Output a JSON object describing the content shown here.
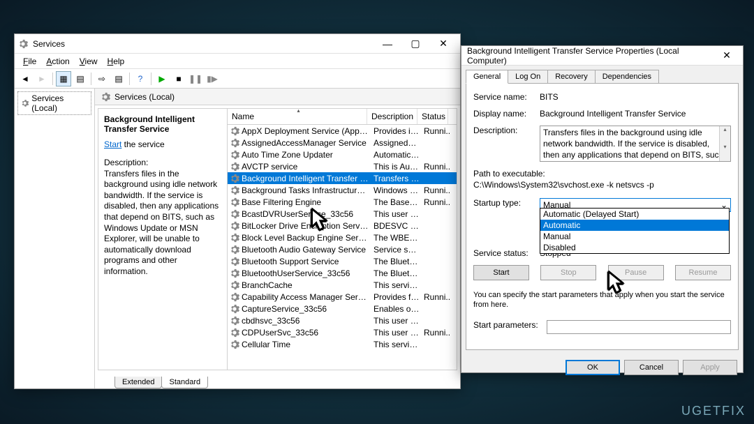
{
  "services_window": {
    "title": "Services",
    "menu": {
      "file": "File",
      "action": "Action",
      "view": "View",
      "help": "Help"
    },
    "tree_item": "Services (Local)",
    "panel_header": "Services (Local)",
    "selected_service": {
      "title": "Background Intelligent Transfer Service",
      "action_prefix": "Start",
      "action_suffix": " the service",
      "desc_label": "Description:",
      "description": "Transfers files in the background using idle network bandwidth. If the service is disabled, then any applications that depend on BITS, such as Windows Update or MSN Explorer, will be unable to automatically download programs and other information."
    },
    "columns": {
      "name": "Name",
      "description": "Description",
      "status": "Status"
    },
    "rows": [
      {
        "name": "AppX Deployment Service (AppXSVC)",
        "desc": "Provides inf...",
        "status": "Runni..."
      },
      {
        "name": "AssignedAccessManager Service",
        "desc": "AssignedAc...",
        "status": ""
      },
      {
        "name": "Auto Time Zone Updater",
        "desc": "Automatica...",
        "status": ""
      },
      {
        "name": "AVCTP service",
        "desc": "This is Audi...",
        "status": "Runni..."
      },
      {
        "name": "Background Intelligent Transfer Service",
        "desc": "Transfers fil...",
        "status": "",
        "selected": true
      },
      {
        "name": "Background Tasks Infrastructure Service",
        "desc": "Windows in...",
        "status": "Runni..."
      },
      {
        "name": "Base Filtering Engine",
        "desc": "The Base Fil...",
        "status": "Runni..."
      },
      {
        "name": "BcastDVRUserService_33c56",
        "desc": "This user ser...",
        "status": ""
      },
      {
        "name": "BitLocker Drive Encryption Service",
        "desc": "BDESVC hos...",
        "status": ""
      },
      {
        "name": "Block Level Backup Engine Service",
        "desc": "The WBENG...",
        "status": ""
      },
      {
        "name": "Bluetooth Audio Gateway Service",
        "desc": "Service sup...",
        "status": ""
      },
      {
        "name": "Bluetooth Support Service",
        "desc": "The Bluetoo...",
        "status": ""
      },
      {
        "name": "BluetoothUserService_33c56",
        "desc": "The Bluetoo...",
        "status": ""
      },
      {
        "name": "BranchCache",
        "desc": "This service...",
        "status": ""
      },
      {
        "name": "Capability Access Manager Service",
        "desc": "Provides fac...",
        "status": "Runni..."
      },
      {
        "name": "CaptureService_33c56",
        "desc": "Enables opti...",
        "status": ""
      },
      {
        "name": "cbdhsvc_33c56",
        "desc": "This user ser...",
        "status": ""
      },
      {
        "name": "CDPUserSvc_33c56",
        "desc": "This user ser...",
        "status": "Runni..."
      },
      {
        "name": "Cellular Time",
        "desc": "This service...",
        "status": ""
      }
    ],
    "bottom_tabs": {
      "extended": "Extended",
      "standard": "Standard"
    }
  },
  "props": {
    "title": "Background Intelligent Transfer Service Properties (Local Computer)",
    "tabs": {
      "general": "General",
      "logon": "Log On",
      "recovery": "Recovery",
      "dependencies": "Dependencies"
    },
    "labels": {
      "service_name": "Service name:",
      "display_name": "Display name:",
      "description": "Description:",
      "path_exe": "Path to executable:",
      "startup_type": "Startup type:",
      "service_status": "Service status:",
      "start_params": "Start parameters:"
    },
    "values": {
      "service_name": "BITS",
      "display_name": "Background Intelligent Transfer Service",
      "description": "Transfers files in the background using idle network bandwidth. If the service is disabled, then any applications that depend on BITS, such as Windows",
      "path": "C:\\Windows\\System32\\svchost.exe -k netsvcs -p",
      "startup_selected": "Manual",
      "status": "Stopped"
    },
    "dropdown_options": [
      "Automatic (Delayed Start)",
      "Automatic",
      "Manual",
      "Disabled"
    ],
    "dropdown_highlight_index": 1,
    "buttons": {
      "start": "Start",
      "stop": "Stop",
      "pause": "Pause",
      "resume": "Resume"
    },
    "help_text": "You can specify the start parameters that apply when you start the service from here.",
    "dlg_buttons": {
      "ok": "OK",
      "cancel": "Cancel",
      "apply": "Apply"
    }
  },
  "watermark": "UGETFIX"
}
